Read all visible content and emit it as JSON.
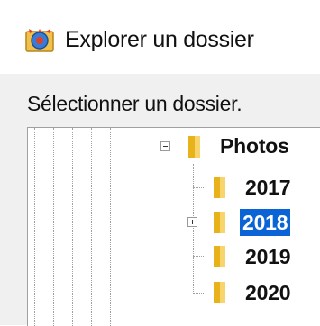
{
  "window": {
    "title": "Explorer un dossier"
  },
  "dialog": {
    "prompt": "Sélectionner un dossier."
  },
  "tree": {
    "items": [
      {
        "label": "Photos",
        "expander": "collapse",
        "selected": false
      },
      {
        "label": "2017",
        "expander": "none",
        "selected": false
      },
      {
        "label": "2018",
        "expander": "expand",
        "selected": true
      },
      {
        "label": "2019",
        "expander": "none",
        "selected": false
      },
      {
        "label": "2020",
        "expander": "none",
        "selected": false
      }
    ]
  },
  "colors": {
    "selection": "#0a64d6",
    "folder": "#e8b31a",
    "dialog_background": "#f0f0f0"
  }
}
